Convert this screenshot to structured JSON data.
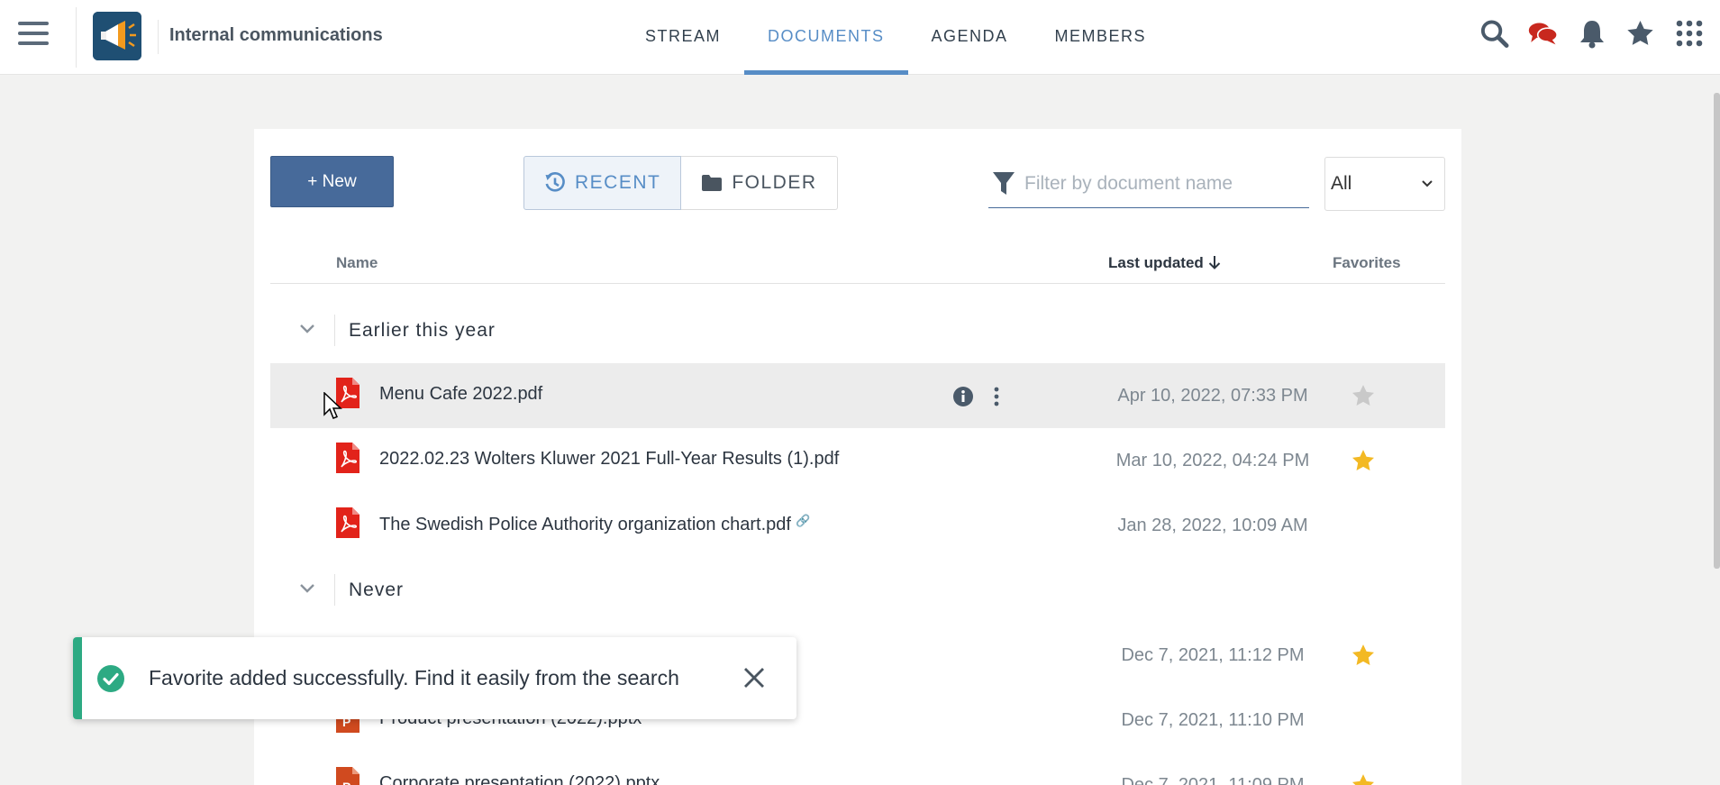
{
  "space": {
    "title": "Internal communications"
  },
  "tabs": [
    {
      "label": "STREAM"
    },
    {
      "label": "DOCUMENTS"
    },
    {
      "label": "AGENDA"
    },
    {
      "label": "MEMBERS"
    }
  ],
  "icons": {
    "menu": "hamburger-icon",
    "search": "search-icon",
    "chat": "chat-icon",
    "bell": "bell-icon",
    "favorites": "star-icon",
    "apps": "grid-icon"
  },
  "colors": {
    "accent": "#578dc6",
    "primary_button": "#476a9a",
    "chat": "#c8281e",
    "pdf": "#e2231a",
    "ppt": "#d04a1f",
    "star_on": "#f3b924",
    "star_off": "#c9c9c9",
    "success": "#2daa83"
  },
  "toolbar": {
    "new_label": "+ New",
    "recent_label": "RECENT",
    "folder_label": "FOLDER",
    "filter_placeholder": "Filter by document name",
    "select_value": "All"
  },
  "table": {
    "col_name": "Name",
    "col_updated": "Last updated",
    "col_favorites": "Favorites"
  },
  "groups": [
    {
      "label": "Earlier this year"
    },
    {
      "label": "Never"
    }
  ],
  "documents": [
    {
      "name": "Menu Cafe 2022.pdf",
      "date": "Apr 10, 2022, 07:33 PM",
      "type": "pdf",
      "favorite": false
    },
    {
      "name": "2022.02.23 Wolters Kluwer 2021 Full-Year Results (1).pdf",
      "date": "Mar 10, 2022, 04:24 PM",
      "type": "pdf",
      "favorite": true
    },
    {
      "name": "The Swedish Police Authority organization chart.pdf",
      "date": "Jan 28, 2022, 10:09 AM",
      "type": "pdf",
      "favorite": false,
      "link": "🔗"
    },
    {
      "name": "",
      "date": "Dec 7, 2021, 11:12 PM",
      "type": "hidden",
      "favorite": true
    },
    {
      "name": "Product presentation (2022).pptx",
      "date": "Dec 7, 2021, 11:10 PM",
      "type": "pptx",
      "favorite": false
    },
    {
      "name": "Corporate presentation (2022).pptx",
      "date": "Dec 7, 2021, 11:09 PM",
      "type": "pptx",
      "favorite": true
    }
  ],
  "toast": {
    "message": "Favorite added successfully. Find it easily from the search"
  }
}
